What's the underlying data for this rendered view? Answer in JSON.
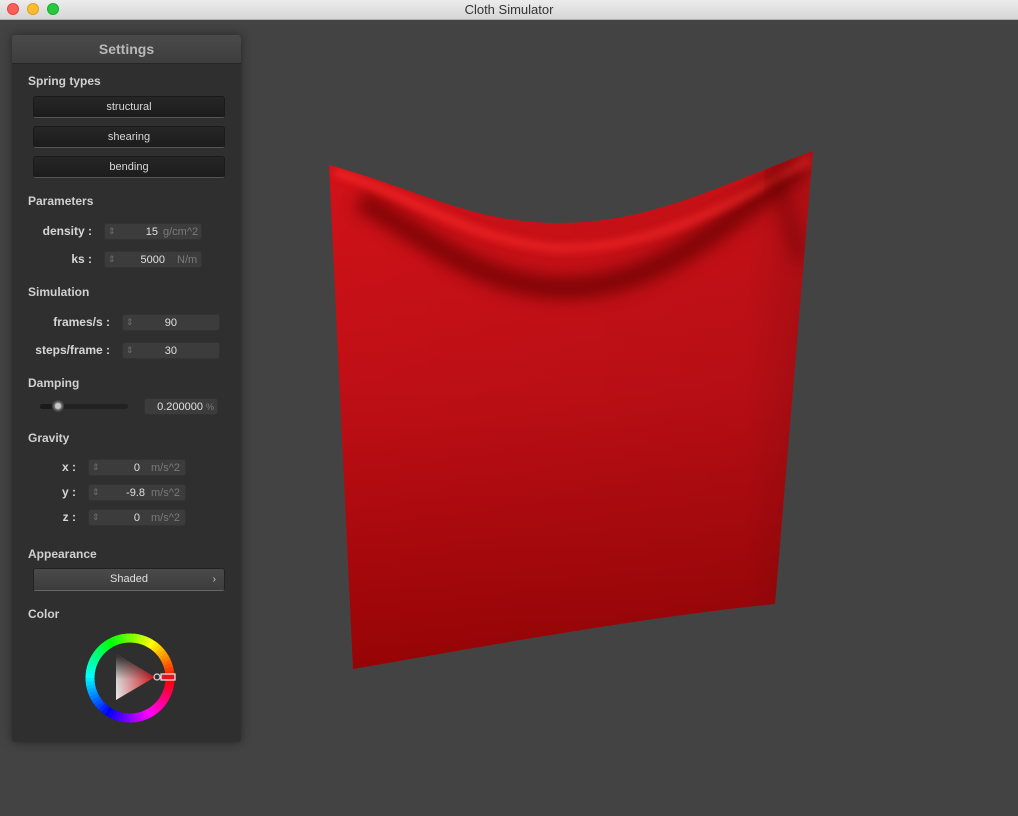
{
  "window": {
    "title": "Cloth Simulator",
    "buttons": [
      "close",
      "minimize",
      "maximize"
    ]
  },
  "settings": {
    "header": "Settings",
    "spring_types": {
      "label": "Spring types",
      "buttons": [
        "structural",
        "shearing",
        "bending"
      ]
    },
    "parameters": {
      "label": "Parameters",
      "density": {
        "label": "density :",
        "value": "15",
        "unit": "g/cm^2"
      },
      "ks": {
        "label": "ks :",
        "value": "5000",
        "unit": "N/m"
      }
    },
    "simulation": {
      "label": "Simulation",
      "frames_per_sec": {
        "label": "frames/s :",
        "value": "90"
      },
      "steps_per_frame": {
        "label": "steps/frame :",
        "value": "30"
      }
    },
    "damping": {
      "label": "Damping",
      "value": "0.200000",
      "unit": "%",
      "slider_fraction": 0.2
    },
    "gravity": {
      "label": "Gravity",
      "x": {
        "label": "x :",
        "value": "0",
        "unit": "m/s^2"
      },
      "y": {
        "label": "y :",
        "value": "-9.8",
        "unit": "m/s^2"
      },
      "z": {
        "label": "z :",
        "value": "0",
        "unit": "m/s^2"
      }
    },
    "appearance": {
      "label": "Appearance",
      "selected": "Shaded",
      "chevron": "›"
    },
    "color": {
      "label": "Color",
      "selected_hex": "#e3141b"
    }
  },
  "spinner_glyph": "⇕",
  "cloth_color": "#c0101a",
  "background_color": "#434343"
}
